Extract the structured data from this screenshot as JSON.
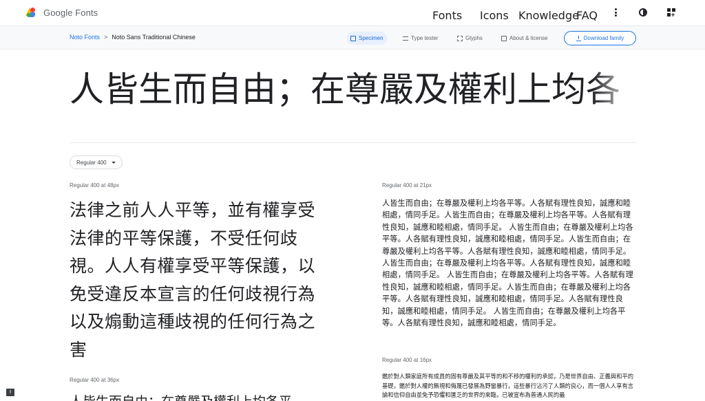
{
  "header": {
    "logo_text": "Google Fonts",
    "nav": [
      "Fonts",
      "Icons",
      "Knowledge",
      "FAQ"
    ]
  },
  "subnav": {
    "breadcrumb_root": "Noto Fonts",
    "breadcrumb_sep": ">",
    "breadcrumb_current": "Noto Sans Traditional Chinese",
    "tabs": [
      "Specimen",
      "Type tester",
      "Glyphs",
      "About & license"
    ],
    "download_label": "Download family"
  },
  "hero_text": "人皆生而自由；在尊嚴及權利上均各",
  "style_select": "Regular 400",
  "samples": {
    "s48_label": "Regular 400 at 48px",
    "s48_text": "法律之前人人平等，並有權享受法律的平等保護，不受任何歧視。人人有權享受平等保護，以免受違反本宣言的任何歧視行為以及煽動這種歧視的任何行為之害",
    "s21_label": "Regular 400 at 21px",
    "s21_text": "人皆生而自由；在尊嚴及權利上均各平等。人各賦有理性良知，誠應和睦相處，情同手足。人皆生而自由；在尊嚴及權利上均各平等。人各賦有理性良知，誠應和睦相處，情同手足。 人皆生而自由；在尊嚴及權利上均各平等。人各賦有理性良知，誠應和睦相處，情同手足。人皆生而自由；在尊嚴及權利上均各平等。人各賦有理性良知，誠應和睦相處，情同手足。 人皆生而自由；在尊嚴及權利上均各平等。人各賦有理性良知，誠應和睦相處，情同手足。 人皆生而自由；在尊嚴及權利上均各平等。人各賦有理性良知，誠應和睦相處，情同手足。人皆生而自由；在尊嚴及權利上均各平等。人各賦有理性良知，誠應和睦相處，情同手足。人各賦有理性良知，誠應和睦相處，情同手足。 人皆生而自由；在尊嚴及權利上均各平等。人各賦有理性良知，誠應和睦相處，情同手足。",
    "s16_label": "Regular 400 at 16px",
    "s16_text": "鑑於對人類家庭所有成員的固有尊嚴及其平等的和不移的權利的承認，乃是世界自由、正義與和平的基礎，鑑於對人權的無視和侮蔑已發展為野蠻暴行，這些暴行沾污了人類的良心，而一個人人享有言論和信仰自由並免予恐懼和匱乏的世界的來臨，已被宣布為普通人民的最",
    "s36_label": "Regular 400 at 36px",
    "s36_text": "人皆生而自由；在尊嚴及權利上均各平"
  },
  "feedback_glyph": "!"
}
